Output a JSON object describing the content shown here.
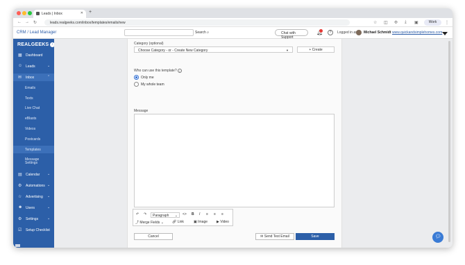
{
  "browser": {
    "tab_title": "Leads | Inbox",
    "url": "leads.realgeeks.com/inbox/templates/emails/new",
    "profile_label": "Work"
  },
  "header": {
    "breadcrumb": "CRM / Lead Manager",
    "search_label": "Search",
    "chat_support": "Chat with Support",
    "logged_in_as": "Logged in as",
    "user_name": "Michael Schmidt",
    "site_link": "www.quickandsimplehomes.com"
  },
  "sidebar": {
    "logo": "REALGEEKS",
    "items": [
      {
        "label": "Dashboard",
        "icon": "dashboard-icon"
      },
      {
        "label": "Leads",
        "icon": "people-icon"
      },
      {
        "label": "Inbox",
        "icon": "inbox-icon"
      },
      {
        "label": "Emails"
      },
      {
        "label": "Texts"
      },
      {
        "label": "Live Chat"
      },
      {
        "label": "eBlasts"
      },
      {
        "label": "Videos"
      },
      {
        "label": "Postcards"
      },
      {
        "label": "Templates"
      },
      {
        "label": "Message Settings"
      },
      {
        "label": "Calendar",
        "icon": "calendar-icon"
      },
      {
        "label": "Automations",
        "icon": "automation-icon"
      },
      {
        "label": "Advertising",
        "icon": "advertising-icon"
      },
      {
        "label": "Users",
        "icon": "users-icon"
      },
      {
        "label": "Settings",
        "icon": "gear-icon"
      },
      {
        "label": "Setup Checklist",
        "icon": "checklist-icon"
      }
    ]
  },
  "form": {
    "category_label": "Category (optional)",
    "category_value": "Choose Category - or - Create New Category",
    "create_button": "+ Create",
    "who_label": "Who can use this template?",
    "option_only_me": "Only me",
    "option_whole_team": "My whole team",
    "message_label": "Message"
  },
  "toolbar": {
    "paragraph": "Paragraph",
    "merge_fields": "Merge Fields",
    "link": "Link",
    "image": "Image",
    "video": "Video"
  },
  "actions": {
    "cancel": "Cancel",
    "send_test": "Send Test Email",
    "save": "Save"
  },
  "colors": {
    "sidebar": "#2c5fa8",
    "accent": "#2c5fa8"
  }
}
